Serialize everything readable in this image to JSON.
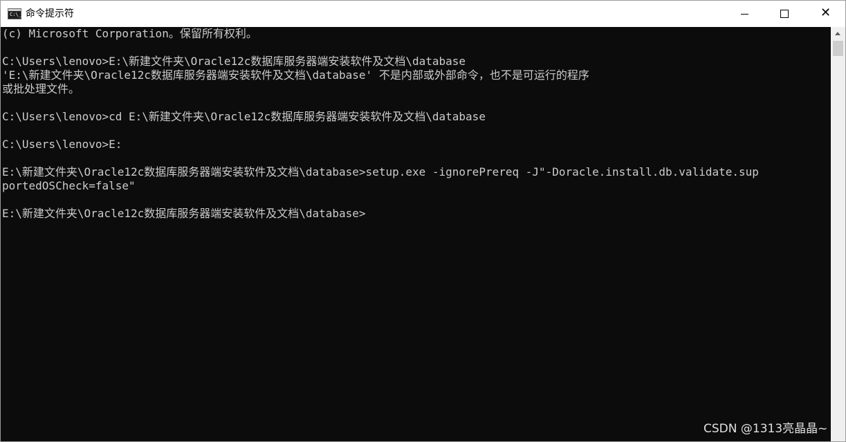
{
  "window": {
    "title": "命令提示符",
    "app_icon_text": "C:\\_",
    "controls": {
      "minimize": "",
      "maximize": "",
      "close": "✕"
    }
  },
  "console": {
    "lines": [
      "(c) Microsoft Corporation。保留所有权利。",
      "",
      "C:\\Users\\lenovo>E:\\新建文件夹\\Oracle12c数据库服务器端安装软件及文档\\database",
      "'E:\\新建文件夹\\Oracle12c数据库服务器端安装软件及文档\\database' 不是内部或外部命令，也不是可运行的程序",
      "或批处理文件。",
      "",
      "C:\\Users\\lenovo>cd E:\\新建文件夹\\Oracle12c数据库服务器端安装软件及文档\\database",
      "",
      "C:\\Users\\lenovo>E:",
      "",
      "E:\\新建文件夹\\Oracle12c数据库服务器端安装软件及文档\\database>setup.exe -ignorePrereq -J\"-Doracle.install.db.validate.sup",
      "portedOSCheck=false\"",
      "",
      "E:\\新建文件夹\\Oracle12c数据库服务器端安装软件及文档\\database>"
    ]
  },
  "watermark": "CSDN @1313亮晶晶~",
  "colors": {
    "console_bg": "#0c0c0c",
    "console_fg": "#cccccc",
    "titlebar_bg": "#ffffff",
    "scrollbar_bg": "#f0f0f0"
  }
}
